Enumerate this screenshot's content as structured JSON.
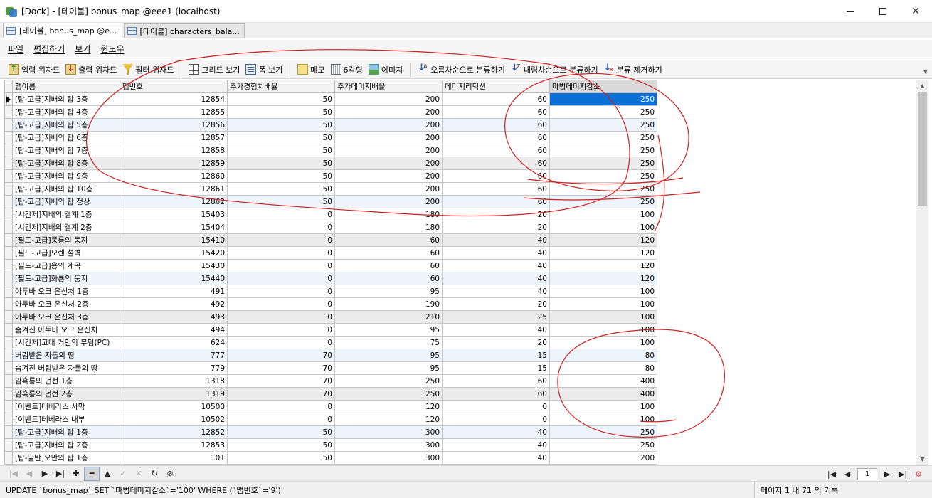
{
  "window": {
    "title": "[Dock] - [테이블] bonus_map @eee1 (localhost)"
  },
  "doc_tabs": [
    {
      "label": "[테이블] bonus_map @e..."
    },
    {
      "label": "[테이블] characters_bala..."
    }
  ],
  "menu": [
    "파일",
    "편집하기",
    "보기",
    "윈도우"
  ],
  "toolbar": {
    "import_wizard": "입력 위자드",
    "export_wizard": "출력 위자드",
    "filter_wizard": "필터 위자드",
    "grid_view": "그리드 보기",
    "form_view": "폼 보기",
    "memo": "메모",
    "hex": "6각형",
    "image": "이미지",
    "sort_asc": "오름차순으로 분류하기",
    "sort_desc": "내림차순으로 분류하기",
    "remove_sort": "분류 제거하기"
  },
  "grid": {
    "columns": [
      "맵이름",
      "맵번호",
      "추가경험치배율",
      "추가데미지배율",
      "데미지리덕션",
      "마법데미지감소"
    ],
    "rows": [
      [
        "[탑-고급]지배의 탑 3층",
        "12854",
        "50",
        "200",
        "60",
        "250"
      ],
      [
        "[탑-고급]지배의 탑 4층",
        "12855",
        "50",
        "200",
        "60",
        "250"
      ],
      [
        "[탑-고급]지배의 탑 5층",
        "12856",
        "50",
        "200",
        "60",
        "250"
      ],
      [
        "[탑-고급]지배의 탑 6층",
        "12857",
        "50",
        "200",
        "60",
        "250"
      ],
      [
        "[탑-고급]지배의 탑 7층",
        "12858",
        "50",
        "200",
        "60",
        "250"
      ],
      [
        "[탑-고급]지배의 탑 8층",
        "12859",
        "50",
        "200",
        "60",
        "250"
      ],
      [
        "[탑-고급]지배의 탑 9층",
        "12860",
        "50",
        "200",
        "60",
        "250"
      ],
      [
        "[탑-고급]지배의 탑 10층",
        "12861",
        "50",
        "200",
        "60",
        "250"
      ],
      [
        "[탑-고급]지배의 탑 정상",
        "12862",
        "50",
        "200",
        "60",
        "250"
      ],
      [
        "[시간제]지배의 결계 1층",
        "15403",
        "0",
        "180",
        "20",
        "100"
      ],
      [
        "[시간제]지배의 결계 2층",
        "15404",
        "0",
        "180",
        "20",
        "100"
      ],
      [
        "[필드-고급]풍룡의 둥지",
        "15410",
        "0",
        "60",
        "40",
        "120"
      ],
      [
        "[필드-고급]오렌 설벽",
        "15420",
        "0",
        "60",
        "40",
        "120"
      ],
      [
        "[필드-고급]용의 계곡",
        "15430",
        "0",
        "60",
        "40",
        "120"
      ],
      [
        "[필드-고급]화룡의 둥지",
        "15440",
        "0",
        "60",
        "40",
        "120"
      ],
      [
        "아투바 오크 은신처 1층",
        "491",
        "0",
        "95",
        "40",
        "100"
      ],
      [
        "아투바 오크 은신처 2층",
        "492",
        "0",
        "190",
        "20",
        "100"
      ],
      [
        "아투바 오크 은신처 3층",
        "493",
        "0",
        "210",
        "25",
        "100"
      ],
      [
        "숨겨진 아투바 오크 은신처",
        "494",
        "0",
        "95",
        "40",
        "100"
      ],
      [
        "[시간제]고대 거인의 무덤(PC)",
        "624",
        "0",
        "75",
        "20",
        "100"
      ],
      [
        "버림받은 자들의 땅",
        "777",
        "70",
        "95",
        "15",
        "80"
      ],
      [
        "숨겨진 버림받은 자들의 땅",
        "779",
        "70",
        "95",
        "15",
        "80"
      ],
      [
        "암흑룡의 던전 1층",
        "1318",
        "70",
        "250",
        "60",
        "400"
      ],
      [
        "암흑룡의 던전 2층",
        "1319",
        "70",
        "250",
        "60",
        "400"
      ],
      [
        "[이벤트]테베라스 사막",
        "10500",
        "0",
        "120",
        "0",
        "100"
      ],
      [
        "[이벤트]테베라스 내부",
        "10502",
        "0",
        "120",
        "0",
        "100"
      ],
      [
        "[탑-고급]지배의 탑 1층",
        "12852",
        "50",
        "300",
        "40",
        "250"
      ],
      [
        "[탑-고급]지배의 탑 2층",
        "12853",
        "50",
        "300",
        "40",
        "250"
      ],
      [
        "[탑-일반]오만의 탑 1층",
        "101",
        "50",
        "300",
        "40",
        "200"
      ]
    ]
  },
  "navigator": {
    "page_value": "1"
  },
  "status": {
    "sql": "UPDATE `bonus_map` SET `마법데미지감소`='100' WHERE (`맵번호`='9')",
    "page_info": "페이지 1 내 71 의 기록"
  }
}
